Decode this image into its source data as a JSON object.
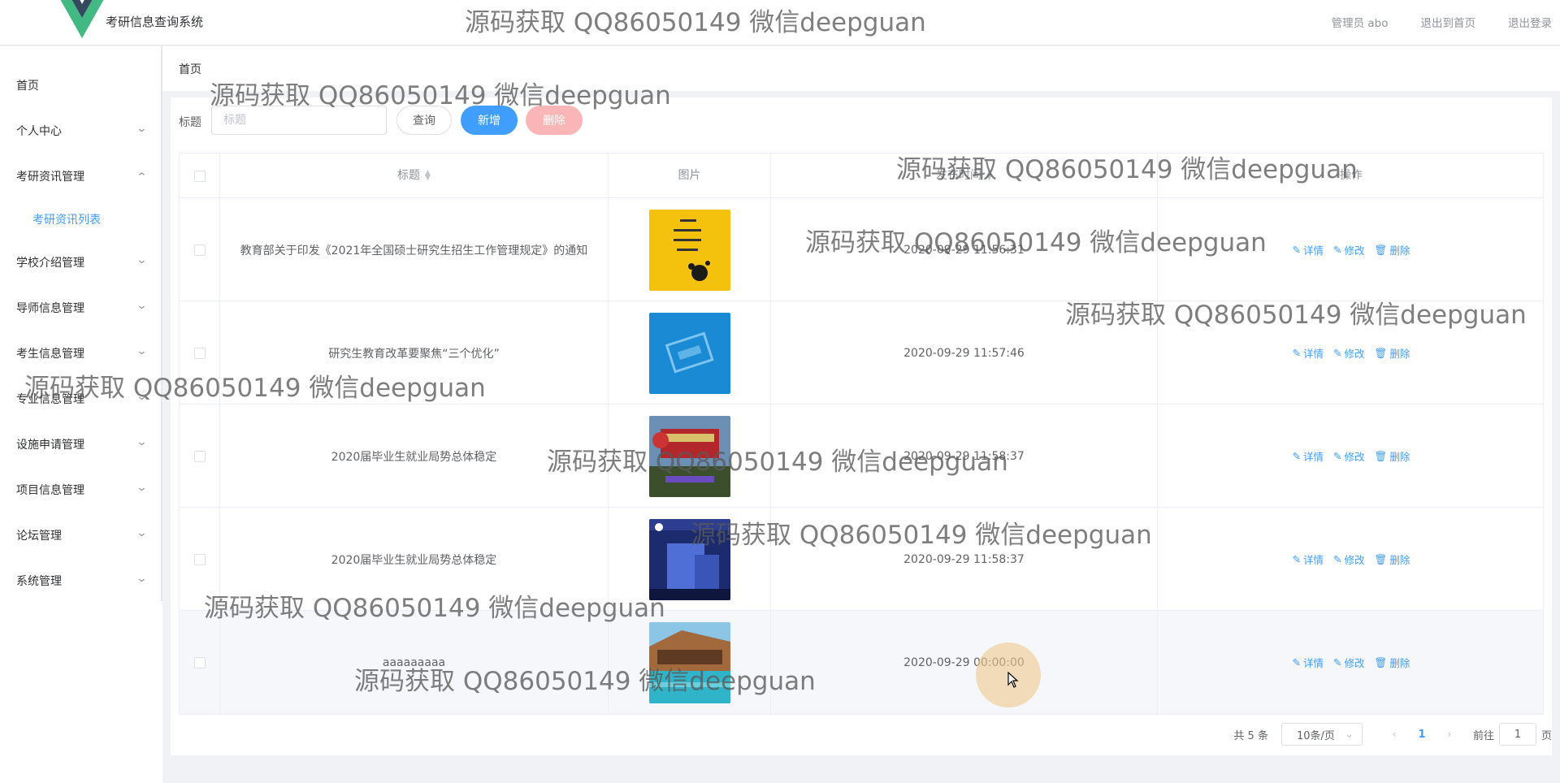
{
  "header": {
    "app_title": "考研信息查询系统",
    "user": "管理员 abo",
    "back_home": "退出到首页",
    "logout": "退出登录"
  },
  "sidebar": {
    "items": [
      {
        "label": "首页",
        "expandable": false
      },
      {
        "label": "个人中心",
        "expandable": true
      },
      {
        "label": "考研资讯管理",
        "expandable": true,
        "expanded": true
      },
      {
        "label": "学校介绍管理",
        "expandable": true
      },
      {
        "label": "导师信息管理",
        "expandable": true
      },
      {
        "label": "考生信息管理",
        "expandable": true
      },
      {
        "label": "专业信息管理",
        "expandable": true
      },
      {
        "label": "设施申请管理",
        "expandable": true
      },
      {
        "label": "项目信息管理",
        "expandable": true
      },
      {
        "label": "论坛管理",
        "expandable": true
      },
      {
        "label": "系统管理",
        "expandable": true
      }
    ],
    "active_sub": "考研资讯列表"
  },
  "breadcrumb": "首页",
  "search": {
    "label": "标题",
    "placeholder": "标题",
    "query_label": "查询",
    "add_label": "新增",
    "delete_label": "删除"
  },
  "table": {
    "headers": [
      "标题",
      "图片",
      "发布时间",
      "操作"
    ],
    "actions": [
      "详情",
      "修改",
      "删除"
    ],
    "rows": [
      {
        "title": "教育部关于印发《2021年全国硕士研究生招生工作管理规定》的通知",
        "time": "2020-09-29 11:56:31",
        "image": "yellow-poster"
      },
      {
        "title": "研究生教育改革要聚焦“三个优化”",
        "time": "2020-09-29 11:57:46",
        "image": "blue-stamp"
      },
      {
        "title": "2020届毕业生就业局势总体稳定",
        "time": "2020-09-29 11:58:37",
        "image": "university-gate"
      },
      {
        "title": "2020届毕业生就业局势总体稳定",
        "time": "2020-09-29 11:58:37",
        "image": "campus-building"
      },
      {
        "title": "aaaaaaaaa",
        "time": "2020-09-29 00:00:00",
        "image": "resort-pool"
      }
    ]
  },
  "pagination": {
    "total": "共 5 条",
    "page_size": "10条/页",
    "current_page": "1",
    "goto_label": "前往",
    "goto_value": "1",
    "page_unit": "页"
  },
  "watermark_text": "源码获取 QQ86050149 微信deepguan",
  "colors": {
    "primary": "#409eff",
    "danger_light": "#fab6b6",
    "logo_green": "#42b883",
    "logo_dark": "#35495e"
  },
  "icons": [
    "vue-logo-icon",
    "chevron-down-icon",
    "chevron-up-icon",
    "sort-caret-icon",
    "edit-icon",
    "delete-icon",
    "chevron-left-icon",
    "chevron-right-icon",
    "cursor-icon"
  ]
}
